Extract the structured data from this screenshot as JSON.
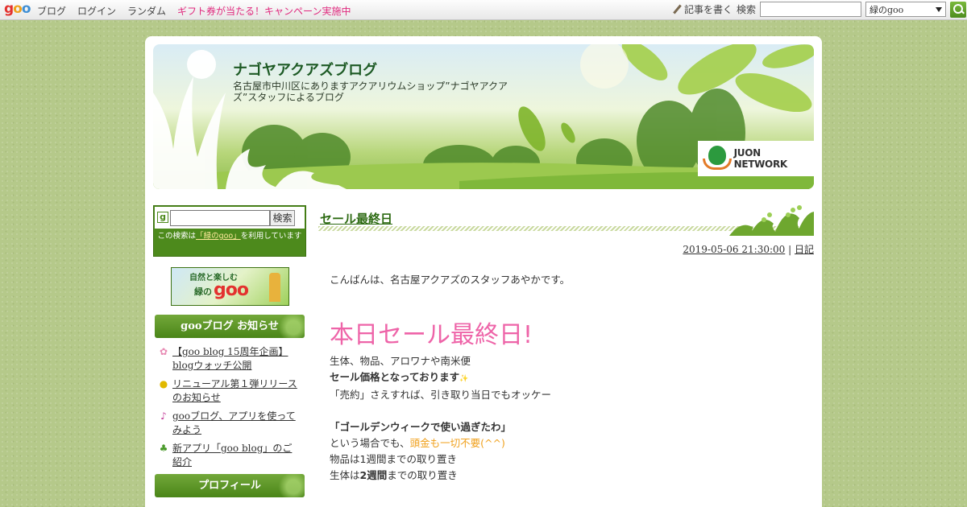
{
  "topbar": {
    "logo": {
      "g": "g",
      "o1": "o",
      "o2": "o"
    },
    "nav": [
      "ブログ",
      "ログイン",
      "ランダム"
    ],
    "promo": "ギフト券が当たる！キャンペーン実施中",
    "write": "記事を書く",
    "search_label": "検索",
    "search_value": "",
    "select_value": "緑のgoo",
    "icons": [
      "pencil-icon",
      "search-icon",
      "chevron-down-icon"
    ]
  },
  "header": {
    "title": "ナゴヤアクアズブログ",
    "description": "名古屋市中川区にありますアクアリウムショップ”ナゴヤアクアズ”スタッフによるブログ",
    "juon_text": "JUON NETWORK"
  },
  "sidebar": {
    "search": {
      "button": "検索",
      "note_pre": "この検索は",
      "note_link": "「緑のgoo」",
      "note_post": "を利用しています"
    },
    "banner": {
      "line1": "自然と楽しむ",
      "line2": "緑の",
      "line3": "goo"
    },
    "news_title": "gooブログ お知らせ",
    "news": [
      {
        "icon": "flower-icon",
        "text": "【goo blog 15周年企画】blogウォッチ公開"
      },
      {
        "icon": "bulb-icon",
        "text": "リニューアル第１弾リリースのお知らせ"
      },
      {
        "icon": "music-note-icon",
        "text": "gooブログ、アプリを使ってみよう"
      },
      {
        "icon": "clover-icon",
        "text": "新アプリ「goo blog」のご紹介"
      }
    ],
    "profile_title": "プロフィール"
  },
  "post": {
    "title": "セール最終日",
    "date": "2019-05-06 21:30:00",
    "separator": "|",
    "category": "日記",
    "greeting": "こんばんは、名古屋アクアズのスタッフあやかです。",
    "headline": "本日セール最終日!",
    "line1": "生体、物品、アロワナや南米便",
    "line2": "セール価格となっております",
    "line3": "「売約」さえすれば、引き取り当日でもオッケー",
    "line4": "「ゴールデンウィークで使い過ぎたわ」",
    "line5_pre": "という場合でも、",
    "line5_orange": "頭金も一切不要(^^)",
    "line6": "物品は1週間までの取り置き",
    "line7_pre": "生体は",
    "line7_bold": "2週間",
    "line7_post": "までの取り置き"
  }
}
